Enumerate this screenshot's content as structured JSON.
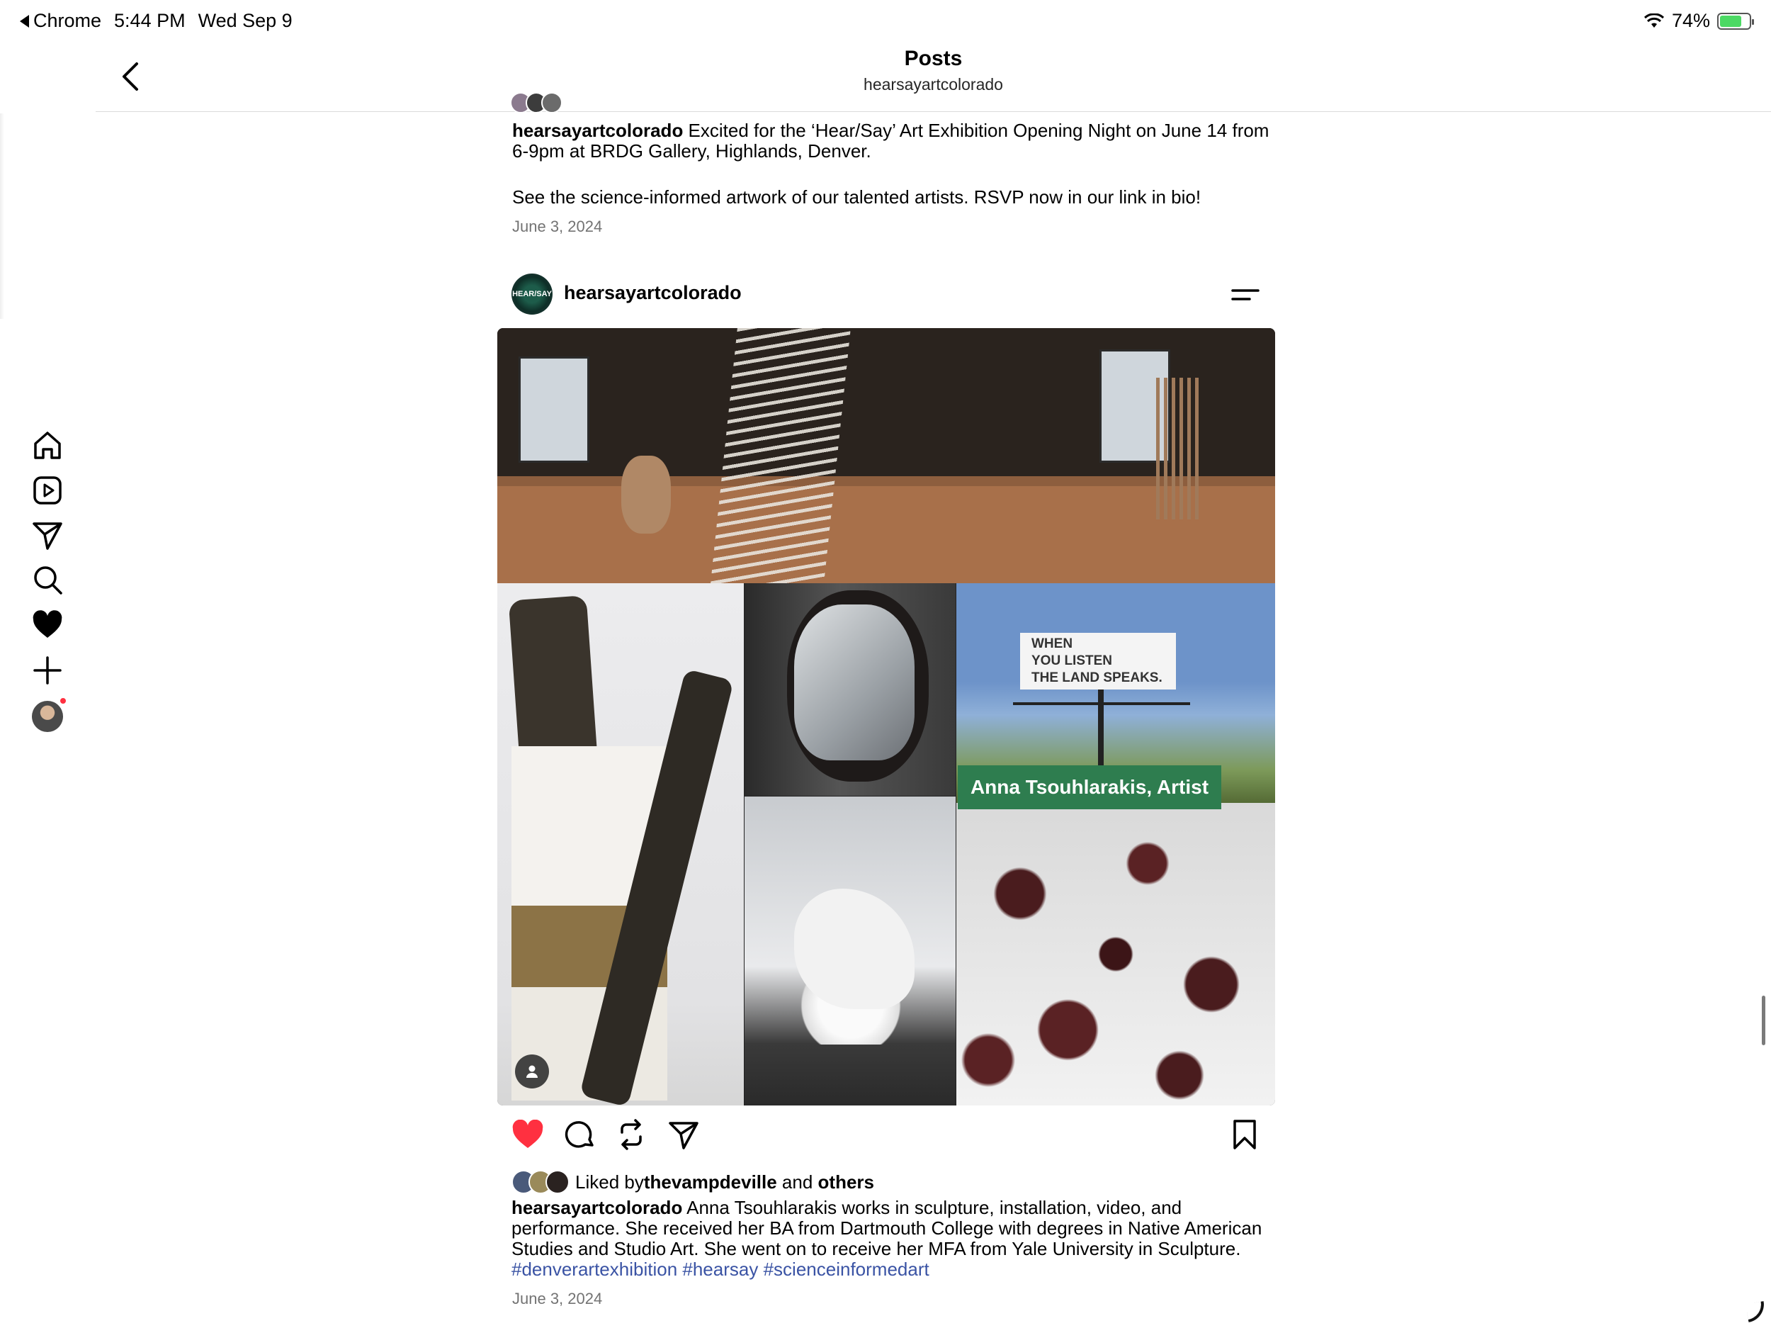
{
  "status_bar": {
    "back_app": "Chrome",
    "time": "5:44 PM",
    "date": "Wed Sep 9",
    "battery": "74%",
    "battery_level": 0.74
  },
  "header": {
    "title": "Posts",
    "subtitle": "hearsayartcolorado"
  },
  "sidenav": {
    "items": [
      "home-icon",
      "reels-icon",
      "messages-icon",
      "search-icon",
      "notifications-icon",
      "create-icon",
      "profile-avatar"
    ]
  },
  "previous_post": {
    "username": "hearsayartcolorado",
    "caption_line1": " Excited for the ‘Hear/Say’ Art Exhibition Opening Night on June 14 from 6-9pm at BRDG Gallery, Highlands, Denver.",
    "caption_line2": "See the science-informed artwork of our talented artists. RSVP now in our link in bio!",
    "date": "June 3, 2024"
  },
  "post": {
    "username": "hearsayartcolorado",
    "avatar_text": "HEAR/SAY",
    "media": {
      "billboard_text": [
        "WHEN",
        "YOU LISTEN",
        "THE LAND SPEAKS."
      ],
      "artist_banner": "Anna Tsouhlarakis, Artist"
    },
    "liked": true,
    "likes": {
      "prefix": "Liked by ",
      "user": "thevampdeville",
      "and": " and ",
      "others": "others"
    },
    "caption": {
      "username": "hearsayartcolorado",
      "text": " Anna Tsouhlarakis works in sculpture, installation, video, and performance. She received her BA from Dartmouth College with degrees in Native American Studies and Studio Art. She went on to receive her MFA from Yale University in Sculpture. ",
      "hashtags": [
        "#denverartexhibition",
        "#hearsay",
        "#scienceinformedart"
      ]
    },
    "date": "June 3, 2024"
  },
  "colors": {
    "like_red": "#ff3040",
    "hashtag_blue": "#3a53a4",
    "banner_green": "#2e7d4f"
  }
}
